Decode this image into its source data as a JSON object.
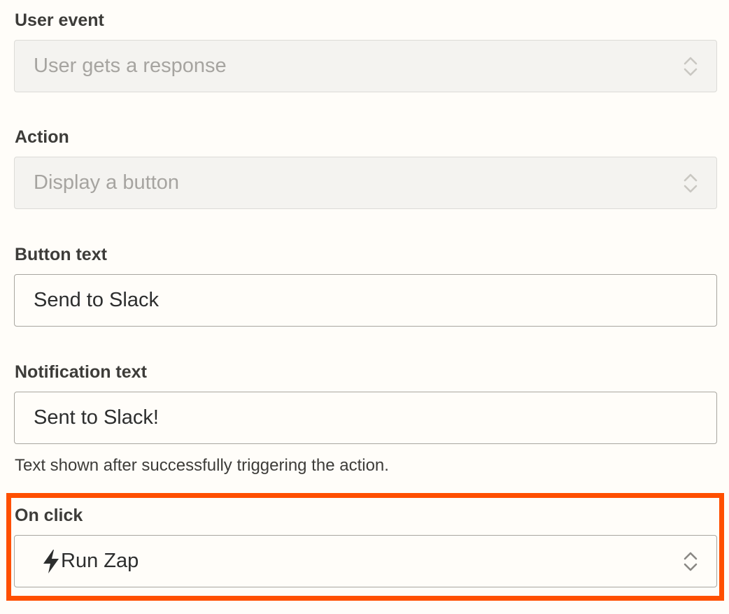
{
  "form": {
    "user_event": {
      "label": "User event",
      "value": "User gets a response"
    },
    "action": {
      "label": "Action",
      "value": "Display a button"
    },
    "button_text": {
      "label": "Button text",
      "value": "Send to Slack"
    },
    "notification_text": {
      "label": "Notification text",
      "value": "Sent to Slack!",
      "help": "Text shown after successfully triggering the action."
    },
    "on_click": {
      "label": "On click",
      "value": "Run Zap",
      "icon": "lightning-bolt-icon"
    }
  },
  "colors": {
    "background": "#fffdf9",
    "highlight": "#ff4f00",
    "disabled_fill": "#f4f3f0"
  }
}
